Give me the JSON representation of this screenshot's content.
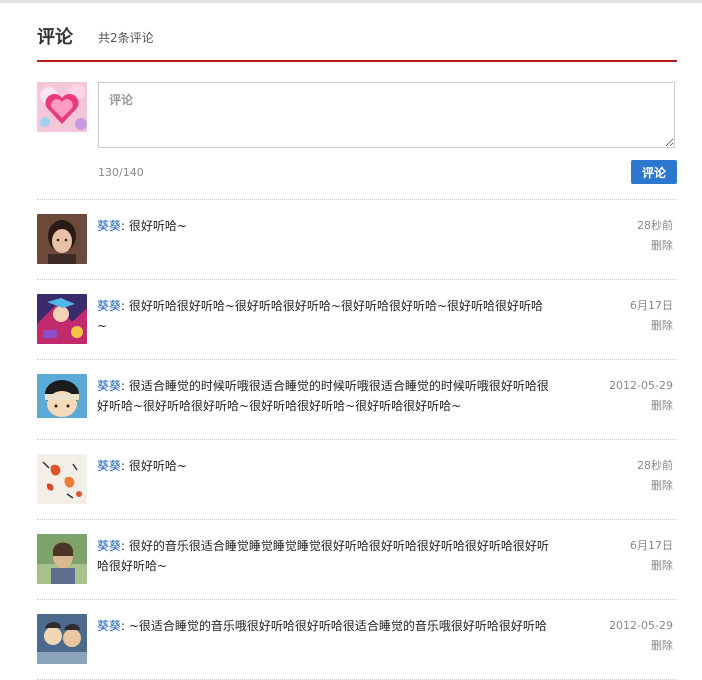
{
  "header": {
    "title": "评论",
    "count": "共2条评论"
  },
  "compose": {
    "placeholder": "评论",
    "counter": "130/140",
    "submit_label": "评论"
  },
  "comments": [
    {
      "user": "葵葵",
      "text": "很好听哈~",
      "time": "28秒前",
      "delete_label": "删除"
    },
    {
      "user": "葵葵",
      "text": "很好听哈很好听哈~很好听哈很好听哈~很好听哈很好听哈~很好听哈很好听哈~",
      "time": "6月17日",
      "delete_label": "删除"
    },
    {
      "user": "葵葵",
      "text": "很适合睡觉的时候听哦很适合睡觉的时候听哦很适合睡觉的时候听哦很好听哈很好听哈~很好听哈很好听哈~很好听哈很好听哈~很好听哈很好听哈~",
      "time": "2012-05-29",
      "delete_label": "删除"
    },
    {
      "user": "葵葵",
      "text": "很好听哈~",
      "time": "28秒前",
      "delete_label": "删除"
    },
    {
      "user": "葵葵",
      "text": "很好的音乐很适合睡觉睡觉睡觉睡觉很好听哈很好听哈很好听哈很好听哈很好听哈很好听哈~",
      "time": "6月17日",
      "delete_label": "删除"
    },
    {
      "user": "葵葵",
      "text": "~很适合睡觉的音乐哦很好听哈很好听哈很适合睡觉的音乐哦很好听哈很好听哈",
      "time": "2012-05-29",
      "delete_label": "删除"
    }
  ]
}
